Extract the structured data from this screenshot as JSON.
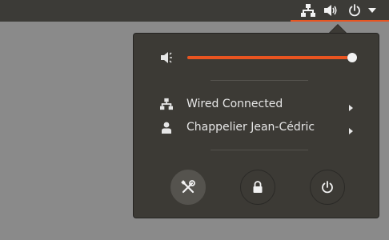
{
  "colors": {
    "accent": "#e95420",
    "panel_bg": "#3c3a35",
    "text": "#e6e6e6"
  },
  "topbar": {
    "icons": [
      "network-icon",
      "volume-icon",
      "power-icon",
      "chevron-down-icon"
    ]
  },
  "volume": {
    "icon": "volume-low-icon",
    "level": 0.98
  },
  "menu": {
    "items": [
      {
        "icon": "network-icon",
        "label": "Wired Connected"
      },
      {
        "icon": "user-icon",
        "label": "Chappelier Jean-Cédric"
      }
    ]
  },
  "actions": [
    {
      "icon": "settings-icon"
    },
    {
      "icon": "lock-icon"
    },
    {
      "icon": "power-icon"
    }
  ]
}
